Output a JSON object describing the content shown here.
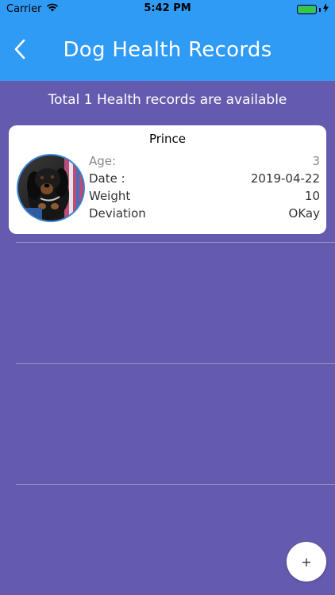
{
  "status_bar": {
    "carrier": "Carrier",
    "time": "5:42 PM",
    "battery_level": 1.0,
    "wifi_icon": "wifi-icon",
    "charging_icon": "bolt-icon"
  },
  "nav": {
    "title": "Dog Health Records",
    "back_icon": "chevron-left-icon"
  },
  "summary": "Total 1 Health records are available",
  "records": [
    {
      "name": "Prince",
      "photo": "dog-photo",
      "age_label": "Age:",
      "age_value": "3",
      "date_label": "Date :",
      "date_value": "2019-04-22",
      "weight_label": "Weight",
      "weight_value": "10",
      "deviation_label": "Deviation",
      "deviation_value": "OKay"
    }
  ],
  "fab": {
    "label": "+"
  },
  "colors": {
    "header": "#2F9BF5",
    "background": "#655BAE",
    "card": "#FFFFFF",
    "avatar_border": "#3A86D9"
  }
}
